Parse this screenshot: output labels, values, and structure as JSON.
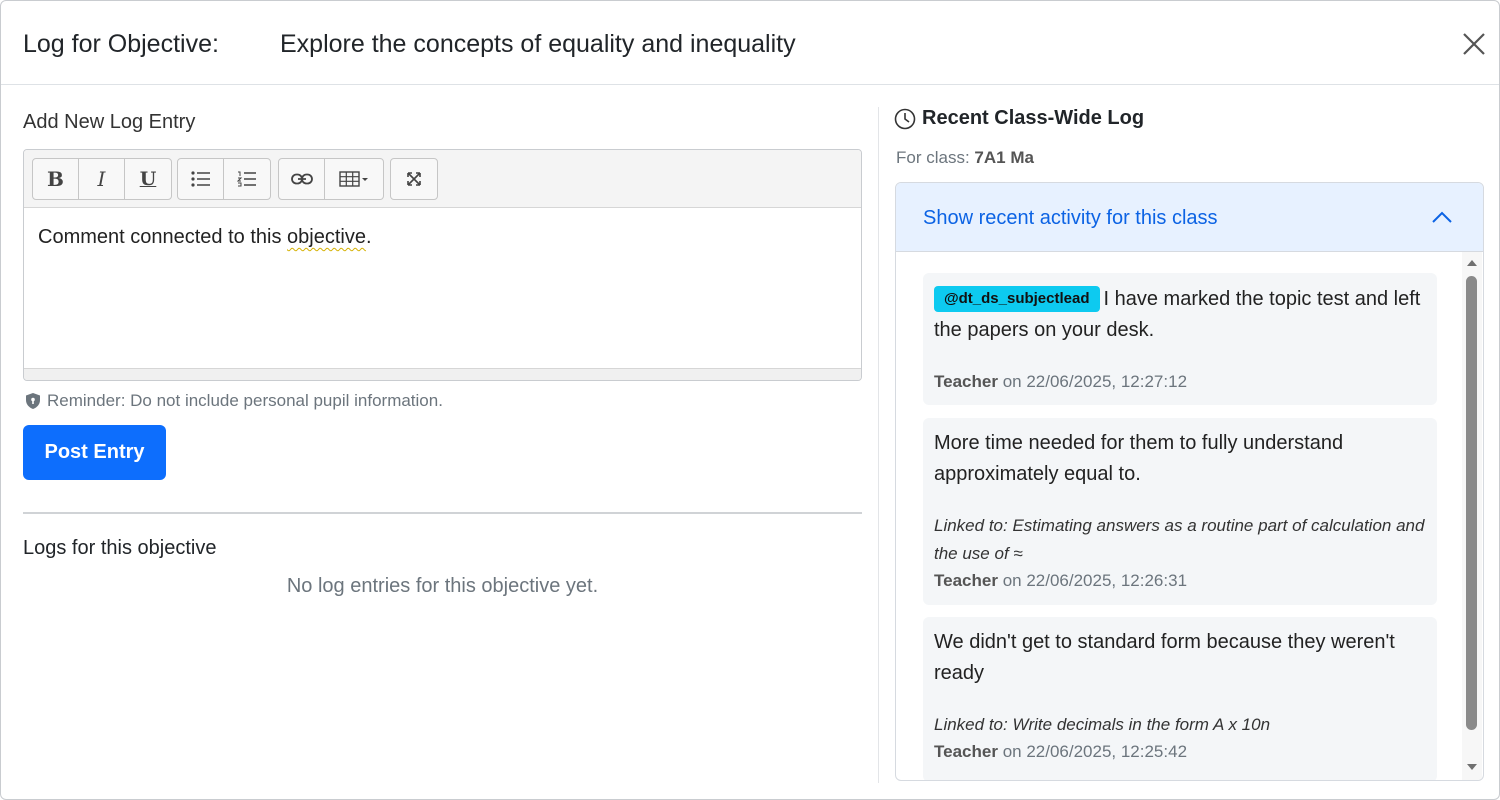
{
  "header": {
    "title_label": "Log for Objective:",
    "objective": "Explore the concepts of equality and inequality",
    "close_icon": "close-icon"
  },
  "left": {
    "add_heading": "Add New Log Entry",
    "toolbar": {
      "bold_label": "B",
      "italic_label": "I",
      "underline_label": "U",
      "icons": [
        "bold-icon",
        "italic-icon",
        "underline-icon",
        "bulleted-list-icon",
        "numbered-list-icon",
        "link-icon",
        "table-icon",
        "fullscreen-icon"
      ]
    },
    "editor_text_before": "Comment connected to this ",
    "editor_text_spell": "objective",
    "editor_text_after": ".",
    "reminder": "Reminder: Do not include personal pupil information.",
    "post_button": "Post Entry",
    "logs_heading": "Logs for this objective",
    "empty_message": "No log entries for this objective yet."
  },
  "right": {
    "heading": "Recent Class-Wide Log",
    "for_class_label": "For class:",
    "class_name": "7A1 Ma",
    "accordion_label": "Show recent activity for this class",
    "entries": [
      {
        "mention": "@dt_ds_subjectlead",
        "text": "I have marked the topic test and left the papers on your desk.",
        "linked": "",
        "author": "Teacher",
        "on": "on 22/06/2025, 12:27:12"
      },
      {
        "mention": "",
        "text": "More time needed for them to fully understand approximately equal to.",
        "linked": "Linked to: Estimating answers as a routine part of calculation and the use of ≈",
        "author": "Teacher",
        "on": "on 22/06/2025, 12:26:31"
      },
      {
        "mention": "",
        "text": "We didn't get to standard form because they weren't ready",
        "linked": "Linked to: Write decimals in the form A x 10n",
        "author": "Teacher",
        "on": "on 22/06/2025, 12:25:42"
      }
    ]
  },
  "colors": {
    "primary": "#0d6efd",
    "accordion_bg": "#e7f1ff",
    "accordion_text": "#0c63e4",
    "mention_bg": "#0dcaf0",
    "muted": "#6c757d"
  }
}
